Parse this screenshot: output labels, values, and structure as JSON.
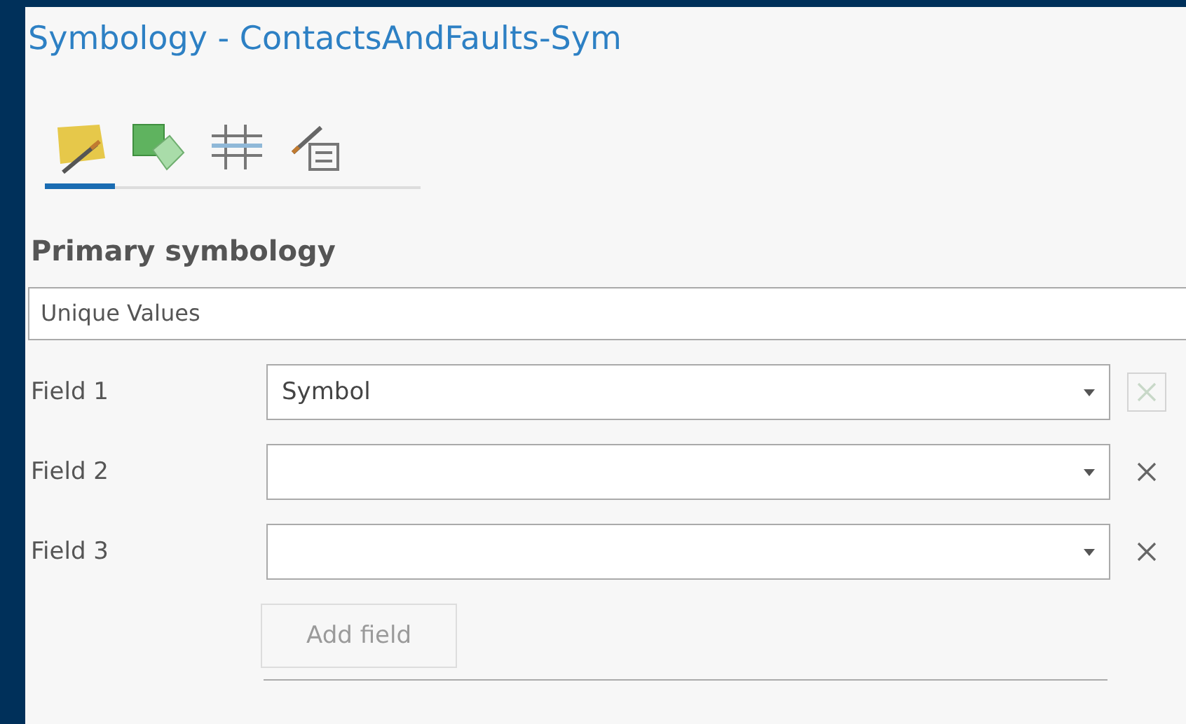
{
  "window": {
    "title": "Symbology - ContactsAndFaults-Sym"
  },
  "tabs": [
    {
      "kind": "polygon",
      "selected": true
    },
    {
      "kind": "layers",
      "selected": false
    },
    {
      "kind": "grid",
      "selected": false
    },
    {
      "kind": "legend",
      "selected": false
    }
  ],
  "primary_symbology": {
    "label": "Primary symbology",
    "value": "Unique Values"
  },
  "fields": [
    {
      "label": "Field 1",
      "value": "Symbol",
      "remove_disabled": true
    },
    {
      "label": "Field 2",
      "remove_disabled": false
    },
    {
      "label": "Field 3",
      "remove_disabled": false
    }
  ],
  "add_field": {
    "label": "Add field",
    "disabled": true
  }
}
